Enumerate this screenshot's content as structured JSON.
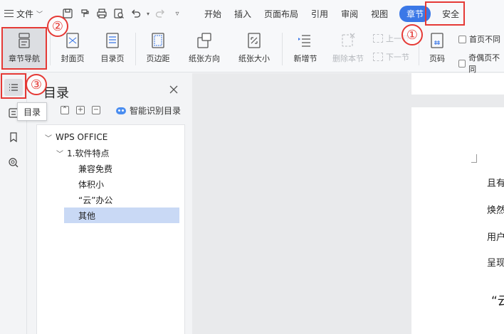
{
  "menubar": {
    "file_label": "文件",
    "tabs": [
      {
        "label": "开始"
      },
      {
        "label": "插入"
      },
      {
        "label": "页面布局"
      },
      {
        "label": "引用"
      },
      {
        "label": "审阅"
      },
      {
        "label": "视图"
      },
      {
        "label": "章节"
      },
      {
        "label": "安全"
      }
    ],
    "active_tab": "章节",
    "accent_color": "#3b78e7"
  },
  "ribbon": {
    "chapter_nav": "章节导航",
    "cover_page": "封面页",
    "toc_page": "目录页",
    "margins": "页边距",
    "orientation": "纸张方向",
    "paper_size": "纸张大小",
    "add_section": "新增节",
    "delete_section": "删除本节",
    "prev_section": "上一节",
    "next_section": "下一节",
    "page_number": "页码",
    "check_first_page": "首页不同",
    "check_odd_even": "奇偶页不同"
  },
  "left_toolbar": {
    "tooltip": "目录"
  },
  "toc_panel": {
    "title": "目录",
    "smart_detect": "智能识别目录",
    "tree": [
      {
        "label": "WPS OFFICE",
        "level": 0,
        "expanded": true
      },
      {
        "label": "1.软件特点",
        "level": 1,
        "expanded": true
      },
      {
        "label": "兼容免费",
        "level": 2
      },
      {
        "label": "体积小",
        "level": 2
      },
      {
        "label": "“云”办公",
        "level": 2
      },
      {
        "label": "其他",
        "level": 2,
        "selected": true
      }
    ]
  },
  "document": {
    "lines": [
      "且有",
      "焕然",
      "用户",
      "呈现"
    ],
    "heading_fragment": "“云"
  },
  "annotations": {
    "circle_1": "①",
    "circle_2": "②",
    "circle_3": "③",
    "color": "#e53935"
  }
}
